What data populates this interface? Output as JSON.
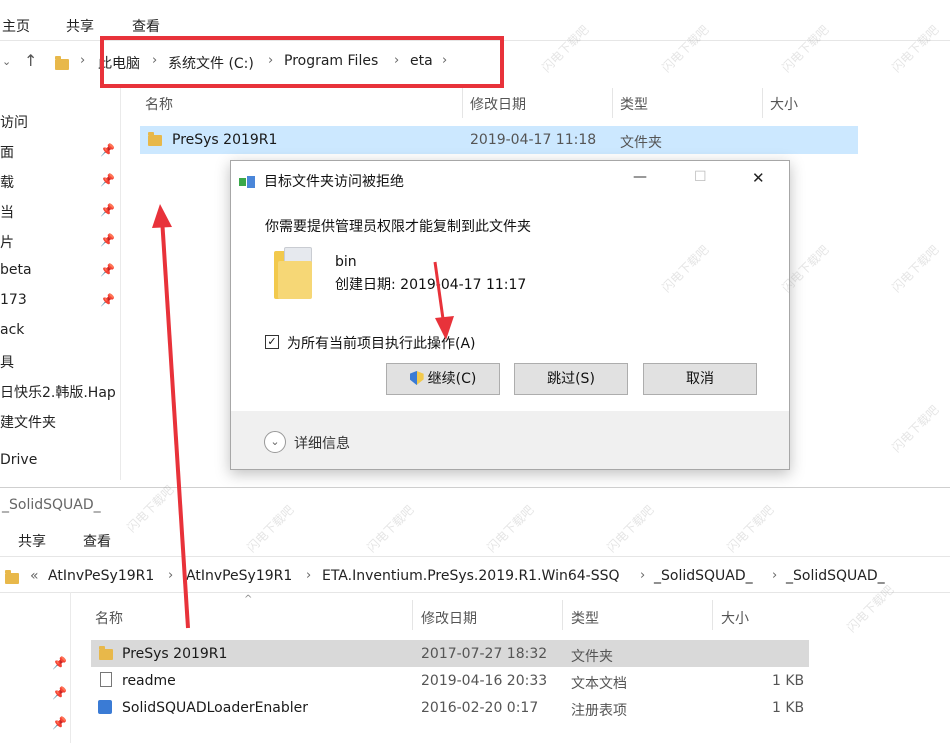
{
  "top_window": {
    "ribbon_tabs": [
      "主页",
      "共享",
      "查看"
    ],
    "breadcrumb": [
      "此电脑",
      "系统文件 (C:)",
      "Program Files",
      "eta"
    ],
    "columns": [
      "名称",
      "修改日期",
      "类型",
      "大小"
    ],
    "nav_items": [
      "访问",
      "面",
      "载",
      "当",
      "片",
      "beta",
      "173",
      "ack",
      "具",
      "日快乐2.韩版.Hap",
      "建文件夹",
      "Drive"
    ],
    "row": {
      "name": "PreSys 2019R1",
      "date": "2019-04-17 11:18",
      "type": "文件夹"
    }
  },
  "dialog": {
    "title": "目标文件夹访问被拒绝",
    "message": "你需要提供管理员权限才能复制到此文件夹",
    "item_name": "bin",
    "item_created": "创建日期: 2019-04-17 11:17",
    "checkbox_label": "为所有当前项目执行此操作(A)",
    "continue_label": "继续(C)",
    "skip_label": "跳过(S)",
    "cancel_label": "取消",
    "details_label": "详细信息",
    "min_glyph": "—",
    "max_glyph": "☐",
    "close_glyph": "✕"
  },
  "bottom_window": {
    "title": "_SolidSQUAD_",
    "ribbon_tabs": [
      "共享",
      "查看"
    ],
    "breadcrumb_prefix": "«",
    "breadcrumb": [
      "AtInvPeSy19R1",
      "AtInvPeSy19R1",
      "ETA.Inventium.PreSys.2019.R1.Win64-SSQ",
      "_SolidSQUAD_",
      "_SolidSQUAD_"
    ],
    "columns": [
      "名称",
      "修改日期",
      "类型",
      "大小"
    ],
    "rows": [
      {
        "name": "PreSys 2019R1",
        "date": "2017-07-27 18:32",
        "type": "文件夹",
        "size": ""
      },
      {
        "name": "readme",
        "date": "2019-04-16 20:33",
        "type": "文本文档",
        "size": "1 KB"
      },
      {
        "name": "SolidSQUADLoaderEnabler",
        "date": "2016-02-20 0:17",
        "type": "注册表项",
        "size": "1 KB"
      }
    ]
  },
  "colors": {
    "accent_red": "#e8323a",
    "selection": "#cce8ff",
    "selection_gray": "#d9d9d9"
  }
}
